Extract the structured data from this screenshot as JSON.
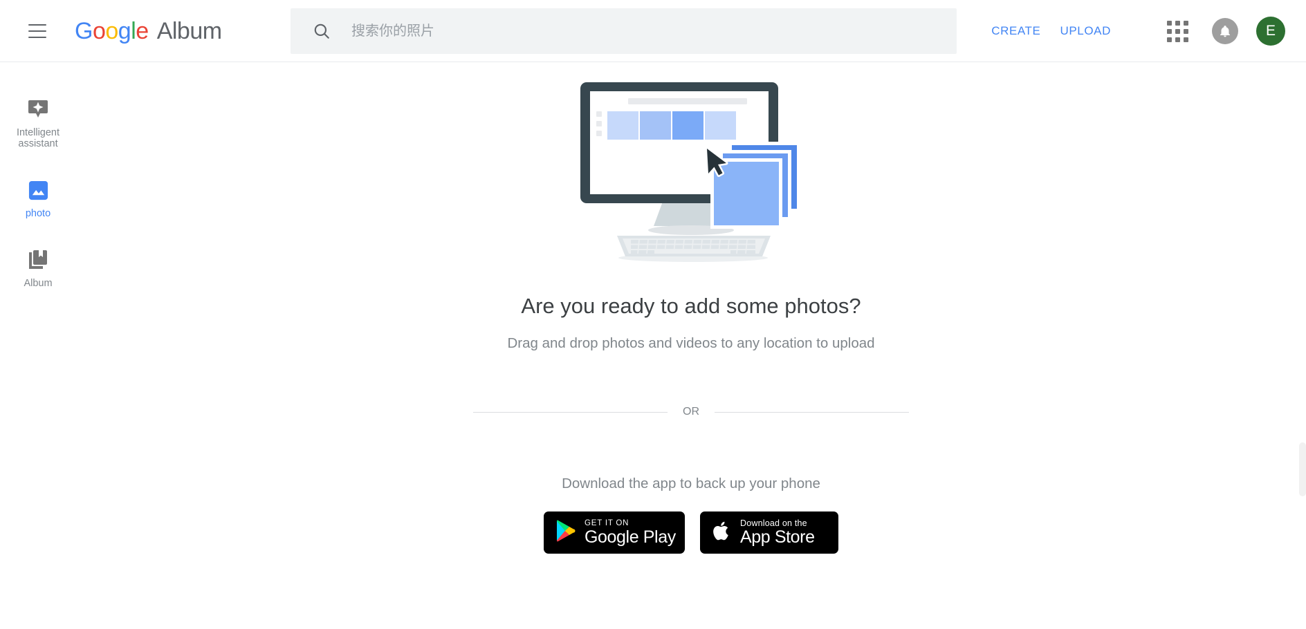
{
  "header": {
    "menu_icon": "hamburger-menu-icon",
    "brand": {
      "g1": "G",
      "o1": "o",
      "o2": "o",
      "g2": "g",
      "l": "l",
      "e": "e",
      "app_name": "Album"
    },
    "search": {
      "icon": "search-icon",
      "placeholder": "搜索你的照片",
      "value": ""
    },
    "create_label": "CREATE",
    "upload_label": "UPLOAD",
    "apps_icon": "apps-grid-icon",
    "bell_icon": "notification-bell-icon",
    "avatar_initial": "E"
  },
  "sidebar": {
    "items": [
      {
        "label": "Intelligent assistant",
        "icon": "assistant-badge-icon",
        "active": false
      },
      {
        "label": "photo",
        "icon": "photo-icon",
        "active": true
      },
      {
        "label": "Album",
        "icon": "album-book-icon",
        "active": false
      }
    ]
  },
  "main": {
    "illustration": "desktop-monitor-keyboard-photos-illustration",
    "headline": "Are you ready to add some photos?",
    "subline": "Drag and drop photos and videos to any location to upload",
    "or_text": "OR",
    "download_text": "Download the app to back up your phone",
    "badges": [
      {
        "small": "GET IT ON",
        "big": "Google Play",
        "icon": "google-play-icon"
      },
      {
        "small": "Download on the",
        "big": "App Store",
        "icon": "apple-logo-icon"
      }
    ]
  },
  "colors": {
    "accent_blue": "#4285f4",
    "google_red": "#ea4335",
    "google_yellow": "#fbbc05",
    "google_green": "#34a853",
    "text_primary": "#3c4043",
    "text_secondary": "#80868b",
    "search_bg": "#f1f3f4",
    "avatar_green": "#2d7031",
    "monitor_dark": "#37474f"
  }
}
